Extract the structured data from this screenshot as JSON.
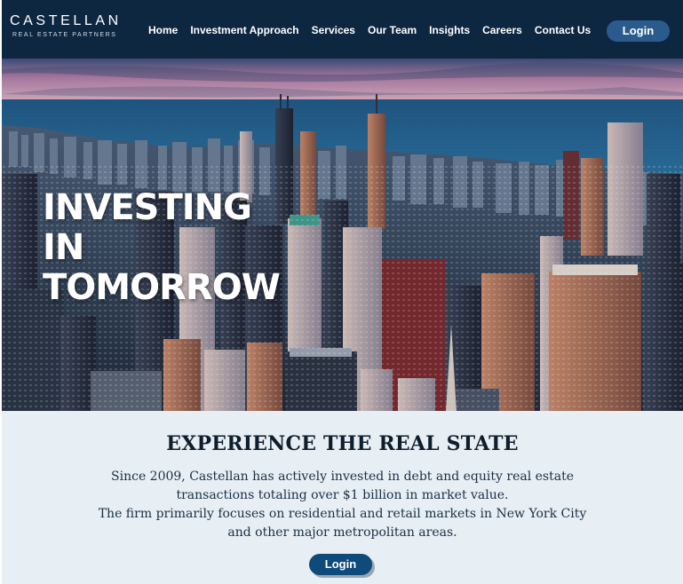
{
  "brand": {
    "name": "CASTELLAN",
    "tagline": "REAL ESTATE PARTNERS"
  },
  "nav": {
    "items": [
      {
        "label": "Home"
      },
      {
        "label": "Investment Approach"
      },
      {
        "label": "Services"
      },
      {
        "label": "Our Team"
      },
      {
        "label": "Insights"
      },
      {
        "label": "Careers"
      },
      {
        "label": "Contact Us"
      }
    ],
    "login_label": "Login"
  },
  "hero": {
    "title_lines": [
      "INVESTING",
      "IN",
      "TOMORROW"
    ],
    "image": "city-skyline-aerial"
  },
  "info": {
    "heading": "EXPERIENCE THE REAL STATE",
    "lines": [
      "Since 2009, Castellan has actively invested in debt and equity real estate",
      "transactions totaling over $1 billion in market value.",
      "The firm primarily focuses on residential and retail markets in New York City",
      "and other major metropolitan areas."
    ],
    "cta_label": "Login"
  },
  "colors": {
    "nav_bg": "#0e2741",
    "nav_login_bg": "#2a5b8c",
    "info_bg": "#e7eef4",
    "cta_bg": "#0e4a7a"
  }
}
